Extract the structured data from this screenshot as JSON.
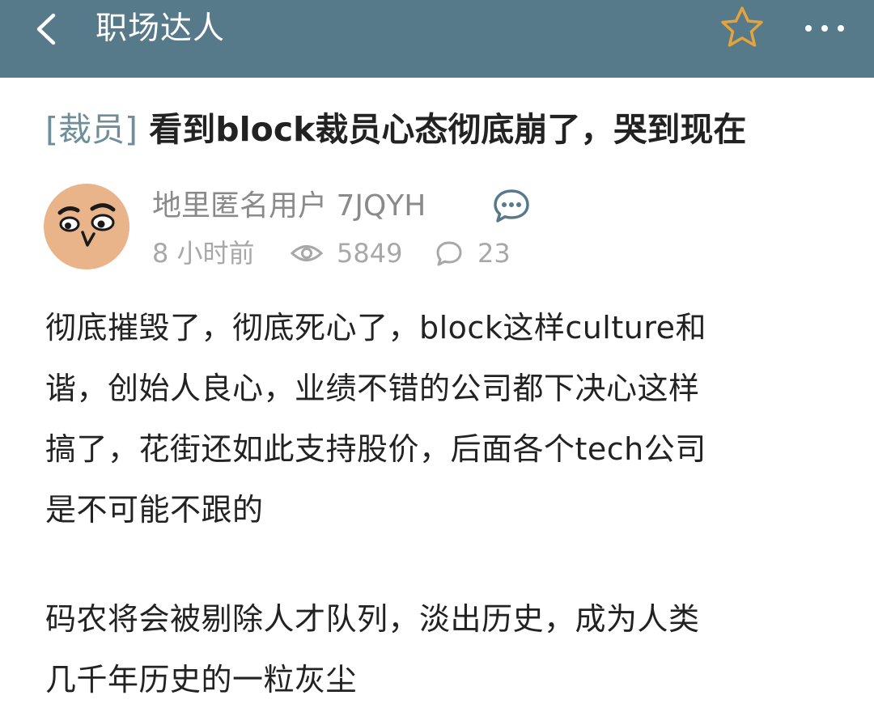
{
  "header": {
    "title": "职场达人",
    "back_icon": "chevron-left-icon",
    "favorite_icon": "star-outline-icon",
    "more_icon": "more-dots-icon",
    "background_color": "#567a89",
    "star_color": "#e3a43b"
  },
  "post": {
    "tag": "[裁员]",
    "title": "看到block裁员心态彻底崩了，哭到现在",
    "author": {
      "name": "地里匿名用户 7JQYH",
      "avatar_icon": "cartoon-face-avatar",
      "message_icon": "chat-bubble-icon"
    },
    "meta": {
      "time": "8 小时前",
      "views": "5849",
      "comments": "23"
    },
    "paragraphs": [
      [
        "彻底摧毁了，彻底死心了，block这样culture和",
        "谐，创始人良心，业绩不错的公司都下决心这样",
        "搞了，花街还如此支持股价，后面各个tech公司",
        "是不可能不跟的"
      ],
      [
        "码农将会被剔除人才队列，淡出历史，成为人类",
        "几千年历史的一粒灰尘"
      ]
    ]
  }
}
